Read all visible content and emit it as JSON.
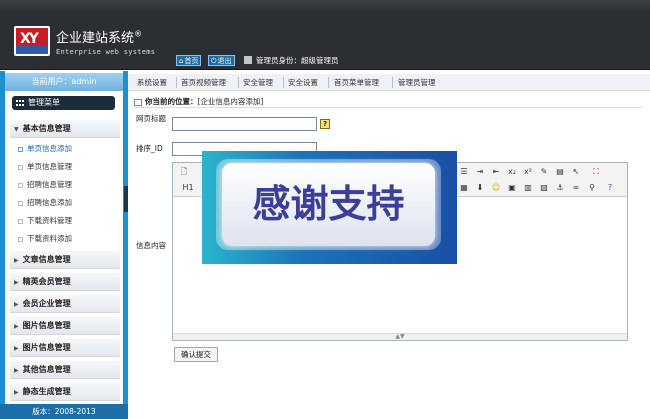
{
  "header": {
    "app_title": "企业建站系统",
    "reg_mark": "®",
    "app_subtitle": "Enterprise web systems",
    "home_label": "首页",
    "logout_label": "退出",
    "role_text": "管理员身份：超级管理员"
  },
  "sidebar": {
    "current_user": "当前用户：admin",
    "menu_label": "管理菜单",
    "sections": [
      {
        "label": "基本信息管理",
        "expanded": true
      },
      {
        "label": "文章信息管理"
      },
      {
        "label": "精英会员管理"
      },
      {
        "label": "会员企业管理"
      },
      {
        "label": "图片信息管理"
      },
      {
        "label": "图片信息管理"
      },
      {
        "label": "其他信息管理"
      },
      {
        "label": "静态生成管理"
      }
    ],
    "sub_items": [
      {
        "label": "单页信息添加",
        "active": true
      },
      {
        "label": "单页信息管理"
      },
      {
        "label": "招聘信息管理"
      },
      {
        "label": "招聘信息添加"
      },
      {
        "label": "下载资料管理"
      },
      {
        "label": "下载资料添加"
      }
    ],
    "version": "版本：2008-2013"
  },
  "topnav": [
    "系统设置",
    "首页视频管理",
    "安全管理",
    "安全设置",
    "首页菜单管理",
    "管理员管理"
  ],
  "location": {
    "prefix": "你当前的位置：",
    "path": "[企业信息内容添加]"
  },
  "form": {
    "title_label": "网页标题",
    "title_value": "",
    "help_icon": "?",
    "sort_label": "排序_ID",
    "sort_value": "",
    "content_label": "信息内容",
    "submit_label": "确认提交"
  },
  "editor": {
    "heading_select": "H1",
    "icons": [
      "source-icon",
      "unordered-list-icon",
      "indent-icon",
      "outdent-icon",
      "subscript-icon",
      "superscript-icon",
      "clear-format-icon",
      "select-all-icon",
      "pointer-icon",
      "fullscreen-icon",
      "table-icon",
      "insert-icon",
      "emoticon-icon",
      "image-icon",
      "flash-icon",
      "media-icon",
      "anchor-icon",
      "link-icon",
      "unlink-icon",
      "help-icon"
    ]
  },
  "overlay": {
    "text": "感谢支持"
  },
  "colors": {
    "header_bg": "#2b2f33",
    "sidebar_frame": "#1e8fd0",
    "accent_button": "#1e6aa3",
    "overlay_text": "#3d3d9a"
  }
}
